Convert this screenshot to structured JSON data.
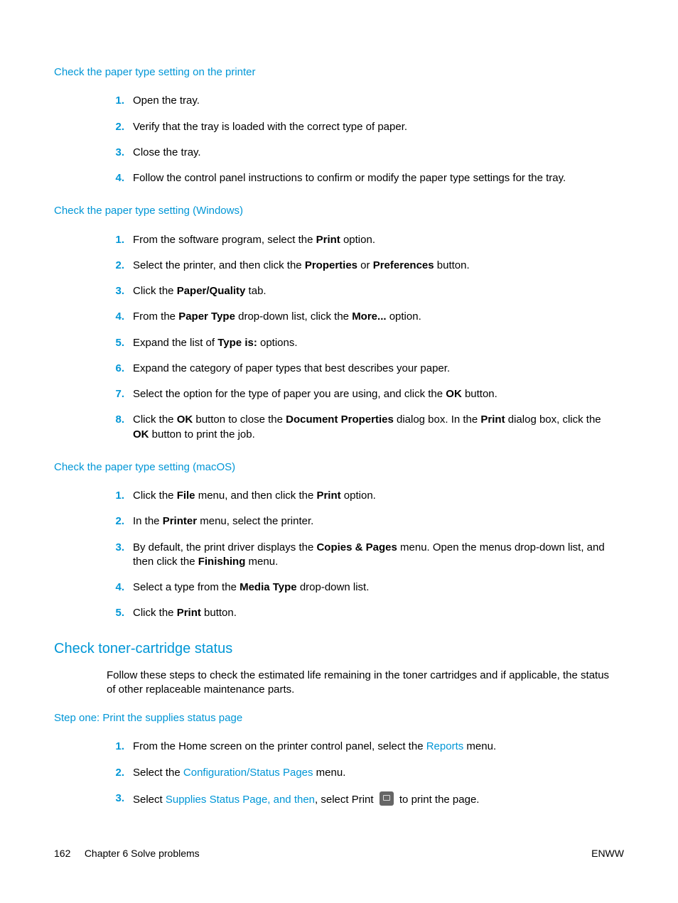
{
  "sec1": {
    "heading": "Check the paper type setting on the printer",
    "steps": [
      [
        {
          "t": "Open the tray."
        }
      ],
      [
        {
          "t": "Verify that the tray is loaded with the correct type of paper."
        }
      ],
      [
        {
          "t": "Close the tray."
        }
      ],
      [
        {
          "t": "Follow the control panel instructions to confirm or modify the paper type settings for the tray."
        }
      ]
    ]
  },
  "sec2": {
    "heading": "Check the paper type setting (Windows)",
    "steps": [
      [
        {
          "t": "From the software program, select the "
        },
        {
          "t": "Print",
          "b": true
        },
        {
          "t": " option."
        }
      ],
      [
        {
          "t": "Select the printer, and then click the "
        },
        {
          "t": "Properties",
          "b": true
        },
        {
          "t": " or "
        },
        {
          "t": "Preferences",
          "b": true
        },
        {
          "t": " button."
        }
      ],
      [
        {
          "t": "Click the "
        },
        {
          "t": "Paper/Quality",
          "b": true
        },
        {
          "t": " tab."
        }
      ],
      [
        {
          "t": "From the "
        },
        {
          "t": "Paper Type",
          "b": true
        },
        {
          "t": " drop-down list, click the "
        },
        {
          "t": "More...",
          "b": true
        },
        {
          "t": " option."
        }
      ],
      [
        {
          "t": "Expand the list of "
        },
        {
          "t": "Type is:",
          "b": true
        },
        {
          "t": " options."
        }
      ],
      [
        {
          "t": "Expand the category of paper types that best describes your paper."
        }
      ],
      [
        {
          "t": "Select the option for the type of paper you are using, and click the "
        },
        {
          "t": "OK",
          "b": true
        },
        {
          "t": " button."
        }
      ],
      [
        {
          "t": "Click the "
        },
        {
          "t": "OK",
          "b": true
        },
        {
          "t": " button to close the "
        },
        {
          "t": "Document Properties",
          "b": true
        },
        {
          "t": " dialog box. In the "
        },
        {
          "t": "Print",
          "b": true
        },
        {
          "t": " dialog box, click the "
        },
        {
          "t": "OK",
          "b": true
        },
        {
          "t": " button to print the job."
        }
      ]
    ]
  },
  "sec3": {
    "heading": "Check the paper type setting (macOS)",
    "steps": [
      [
        {
          "t": "Click the "
        },
        {
          "t": "File",
          "b": true
        },
        {
          "t": " menu, and then click the "
        },
        {
          "t": "Print",
          "b": true
        },
        {
          "t": " option."
        }
      ],
      [
        {
          "t": "In the "
        },
        {
          "t": "Printer",
          "b": true
        },
        {
          "t": " menu, select the printer."
        }
      ],
      [
        {
          "t": "By default, the print driver displays the "
        },
        {
          "t": "Copies & Pages",
          "b": true
        },
        {
          "t": " menu. Open the menus drop-down list, and then click the "
        },
        {
          "t": "Finishing",
          "b": true
        },
        {
          "t": " menu."
        }
      ],
      [
        {
          "t": "Select a type from the "
        },
        {
          "t": "Media Type",
          "b": true
        },
        {
          "t": " drop-down list."
        }
      ],
      [
        {
          "t": "Click the "
        },
        {
          "t": "Print",
          "b": true
        },
        {
          "t": " button."
        }
      ]
    ]
  },
  "sec4": {
    "heading": "Check toner-cartridge status",
    "intro": "Follow these steps to check the estimated life remaining in the toner cartridges and if applicable, the status of other replaceable maintenance parts.",
    "subheading": "Step one: Print the supplies status page",
    "steps": [
      [
        {
          "t": "From the Home screen on the printer control panel, select the "
        },
        {
          "t": "Reports",
          "link": true
        },
        {
          "t": " menu."
        }
      ],
      [
        {
          "t": "Select the "
        },
        {
          "t": "Configuration/Status Pages",
          "link": true
        },
        {
          "t": " menu."
        }
      ],
      [
        {
          "t": "Select "
        },
        {
          "t": "Supplies Status Page, and then",
          "link": true
        },
        {
          "t": ", select Print "
        },
        {
          "icon": true
        },
        {
          "t": " to print the page."
        }
      ]
    ]
  },
  "footer": {
    "left_page": "162",
    "left_chapter": "Chapter 6   Solve problems",
    "right": "ENWW"
  }
}
